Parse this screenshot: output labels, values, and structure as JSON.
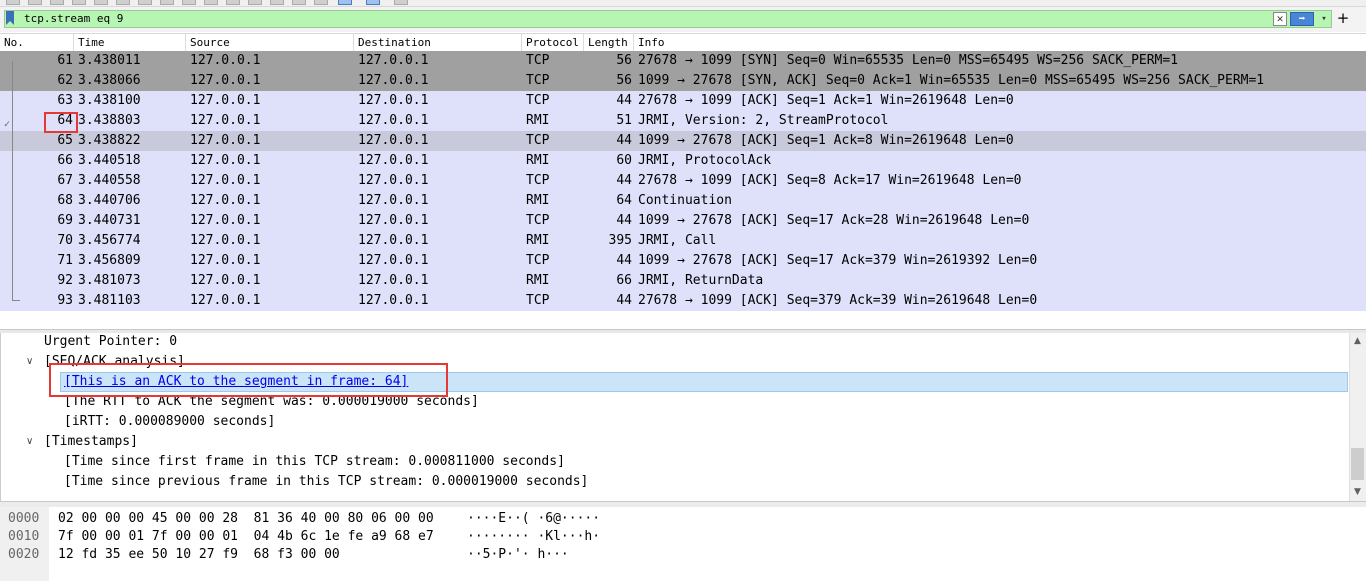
{
  "filter": {
    "text": "tcp.stream eq 9",
    "clear_glyph": "✕",
    "apply_glyph": "➡",
    "dropdown_glyph": "▾",
    "add_glyph": "+"
  },
  "packet_list": {
    "columns": [
      "No.",
      "Time",
      "Source",
      "Destination",
      "Protocol",
      "Length",
      "Info"
    ],
    "rows": [
      {
        "no": "61",
        "time": "3.438011",
        "src": "127.0.0.1",
        "dst": "127.0.0.1",
        "proto": "TCP",
        "len": "56",
        "info": "27678 → 1099 [SYN] Seq=0 Win=65535 Len=0 MSS=65495 WS=256 SACK_PERM=1"
      },
      {
        "no": "62",
        "time": "3.438066",
        "src": "127.0.0.1",
        "dst": "127.0.0.1",
        "proto": "TCP",
        "len": "56",
        "info": "1099 → 27678 [SYN, ACK] Seq=0 Ack=1 Win=65535 Len=0 MSS=65495 WS=256 SACK_PERM=1"
      },
      {
        "no": "63",
        "time": "3.438100",
        "src": "127.0.0.1",
        "dst": "127.0.0.1",
        "proto": "TCP",
        "len": "44",
        "info": "27678 → 1099 [ACK] Seq=1 Ack=1 Win=2619648 Len=0"
      },
      {
        "no": "64",
        "time": "3.438803",
        "src": "127.0.0.1",
        "dst": "127.0.0.1",
        "proto": "RMI",
        "len": "51",
        "info": "JRMI, Version: 2, StreamProtocol"
      },
      {
        "no": "65",
        "time": "3.438822",
        "src": "127.0.0.1",
        "dst": "127.0.0.1",
        "proto": "TCP",
        "len": "44",
        "info": "1099 → 27678 [ACK] Seq=1 Ack=8 Win=2619648 Len=0"
      },
      {
        "no": "66",
        "time": "3.440518",
        "src": "127.0.0.1",
        "dst": "127.0.0.1",
        "proto": "RMI",
        "len": "60",
        "info": "JRMI, ProtocolAck"
      },
      {
        "no": "67",
        "time": "3.440558",
        "src": "127.0.0.1",
        "dst": "127.0.0.1",
        "proto": "TCP",
        "len": "44",
        "info": "27678 → 1099 [ACK] Seq=8 Ack=17 Win=2619648 Len=0"
      },
      {
        "no": "68",
        "time": "3.440706",
        "src": "127.0.0.1",
        "dst": "127.0.0.1",
        "proto": "RMI",
        "len": "64",
        "info": "Continuation"
      },
      {
        "no": "69",
        "time": "3.440731",
        "src": "127.0.0.1",
        "dst": "127.0.0.1",
        "proto": "TCP",
        "len": "44",
        "info": "1099 → 27678 [ACK] Seq=17 Ack=28 Win=2619648 Len=0"
      },
      {
        "no": "70",
        "time": "3.456774",
        "src": "127.0.0.1",
        "dst": "127.0.0.1",
        "proto": "RMI",
        "len": "395",
        "info": "JRMI, Call"
      },
      {
        "no": "71",
        "time": "3.456809",
        "src": "127.0.0.1",
        "dst": "127.0.0.1",
        "proto": "TCP",
        "len": "44",
        "info": "1099 → 27678 [ACK] Seq=17 Ack=379 Win=2619392 Len=0"
      },
      {
        "no": "92",
        "time": "3.481073",
        "src": "127.0.0.1",
        "dst": "127.0.0.1",
        "proto": "RMI",
        "len": "66",
        "info": "JRMI, ReturnData"
      },
      {
        "no": "93",
        "time": "3.481103",
        "src": "127.0.0.1",
        "dst": "127.0.0.1",
        "proto": "TCP",
        "len": "44",
        "info": "27678 → 1099 [ACK] Seq=379 Ack=39 Win=2619648 Len=0"
      }
    ]
  },
  "details": {
    "urgent_pointer": "Urgent Pointer: 0",
    "seq_ack_analysis": "[SEQ/ACK analysis]",
    "ack_to_segment": "[This is an ACK to the segment in frame: 64]",
    "rtt": "[The RTT to ACK the segment was: 0.000019000 seconds]",
    "irtt": "[iRTT: 0.000089000 seconds]",
    "timestamps": "[Timestamps]",
    "time_first": "[Time since first frame in this TCP stream: 0.000811000 seconds]",
    "time_prev": "[Time since previous frame in this TCP stream: 0.000019000 seconds]",
    "expand_glyph": "∨"
  },
  "bytes": [
    {
      "offset": "0000",
      "hex": "02 00 00 00 45 00 00 28  81 36 40 00 80 06 00 00",
      "ascii": "····E··( ·6@·····"
    },
    {
      "offset": "0010",
      "hex": "7f 00 00 01 7f 00 00 01  04 4b 6c 1e fe a9 68 e7",
      "ascii": "········ ·Kl···h·"
    },
    {
      "offset": "0020",
      "hex": "12 fd 35 ee 50 10 27 f9  68 f3 00 00",
      "ascii": "··5·P·'· h···"
    }
  ],
  "scrollbar": {
    "up": "▲",
    "down": "▼"
  },
  "colors": {
    "filter_bg": "#b7f5b3",
    "tcp_row": "#dfe1fb",
    "syn_row": "#a0a0a0",
    "selected_row": "#c9c9dc",
    "highlight_box": "#e53935"
  }
}
